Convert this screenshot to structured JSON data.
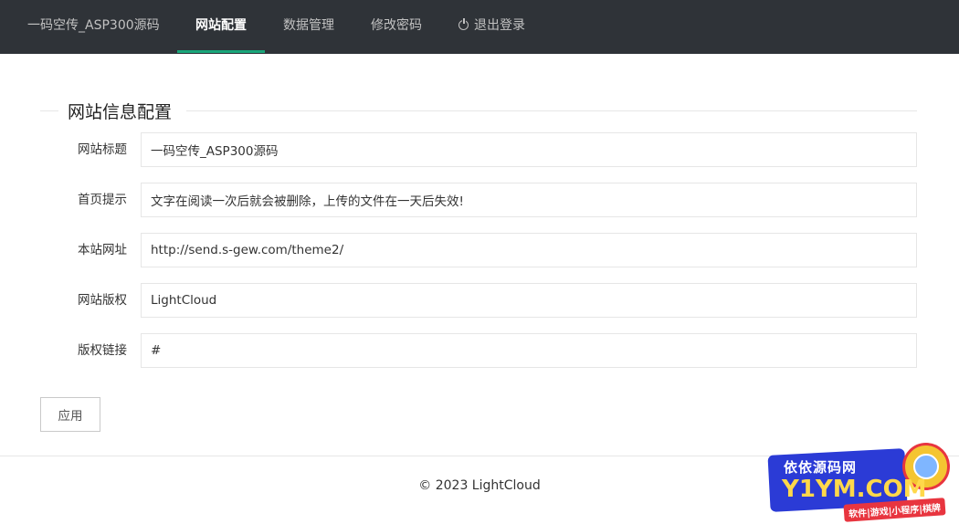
{
  "nav": {
    "brand": "一码空传_ASP300源码",
    "items": [
      {
        "label": "网站配置",
        "active": true
      },
      {
        "label": "数据管理",
        "active": false
      },
      {
        "label": "修改密码",
        "active": false
      },
      {
        "label": "退出登录",
        "icon": "power-icon",
        "active": false
      }
    ]
  },
  "form": {
    "legend": "网站信息配置",
    "fields": [
      {
        "label": "网站标题",
        "value": "一码空传_ASP300源码"
      },
      {
        "label": "首页提示",
        "value": "文字在阅读一次后就会被删除，上传的文件在一天后失效!"
      },
      {
        "label": "本站网址",
        "value": "http://send.s-gew.com/theme2/"
      },
      {
        "label": "网站版权",
        "value": "LightCloud"
      },
      {
        "label": "版权链接",
        "value": "#"
      }
    ],
    "apply_label": "应用"
  },
  "footer": {
    "text": "© 2023 LightCloud"
  },
  "watermark": {
    "line1": "依依源码网",
    "line2": "Y1YM.COM",
    "line3": "软件|游戏|小程序|棋牌"
  },
  "colors": {
    "topbar": "#2f3338",
    "accent": "#1aa67a"
  }
}
